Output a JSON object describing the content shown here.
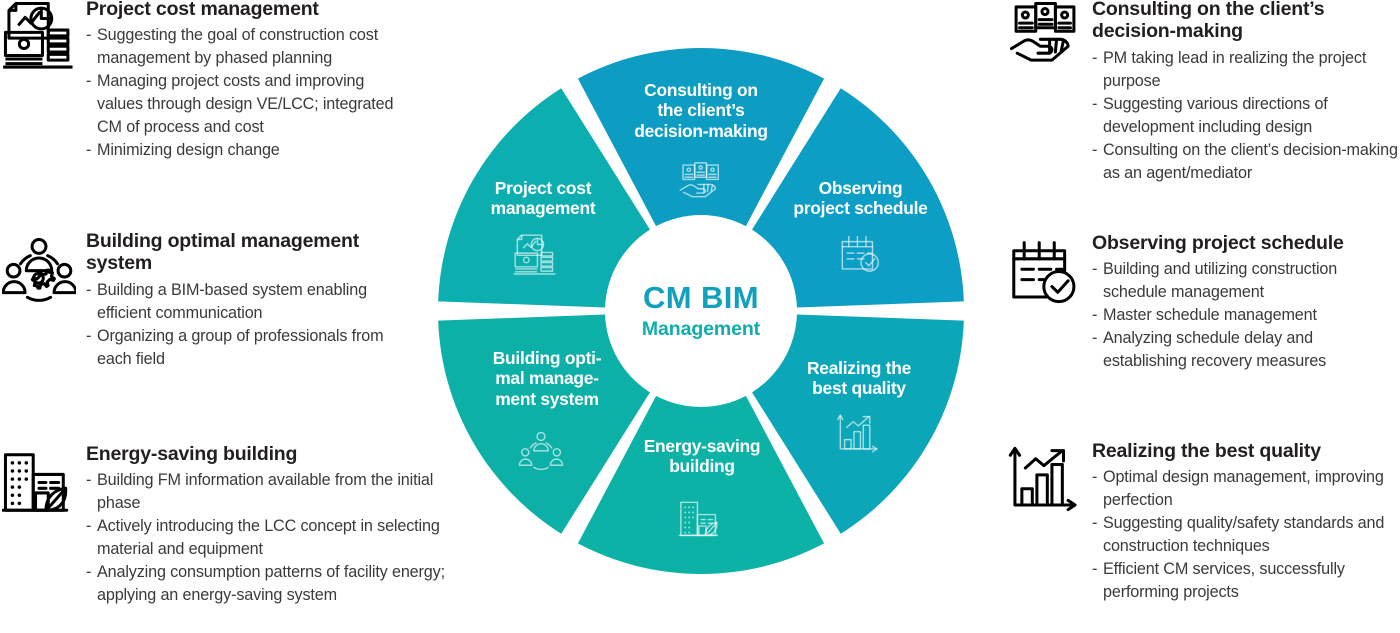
{
  "center": {
    "title": "CM BIM",
    "subtitle": "Management",
    "title_color": "#13A0BC",
    "subtitle_color": "#0FAEAA"
  },
  "colors": {
    "segment_start": "#0C9DC0",
    "segment_end": "#0DB0A5",
    "heading": "#231f20",
    "body": "#3a3a3a",
    "gap": "#ffffff"
  },
  "wheel": {
    "segments": [
      {
        "id": "project-cost-management",
        "label": "Project cost\nmanagement",
        "icon": "money-chart-icon",
        "color": "#0D9DC3"
      },
      {
        "id": "consulting-decision",
        "label": "Consulting on\nthe client’s\ndecision-making",
        "icon": "hand-cards-icon",
        "color": "#0C9EC4"
      },
      {
        "id": "observing-schedule",
        "label": "Observing\nproject schedule",
        "icon": "calendar-check-icon",
        "color": "#0BA7B9"
      },
      {
        "id": "realizing-best-quality",
        "label": "Realizing the\nbest quality",
        "icon": "bar-chart-arrow-icon",
        "color": "#0CB2A6"
      },
      {
        "id": "energy-saving-building",
        "label": "Energy-saving\nbuilding",
        "icon": "building-leaf-icon",
        "color": "#0DB0A7"
      },
      {
        "id": "building-optimal-system",
        "label": "Building opti-\nmal manage-\nment system",
        "icon": "team-gear-icon",
        "color": "#0DAEAF"
      }
    ]
  },
  "blocks": {
    "project_cost": {
      "title": "Project cost management",
      "icon": "money-chart-icon",
      "bullets": [
        "Suggesting the goal of construction cost management by phased planning",
        "Managing project costs and improving values through design VE/LCC; integrated CM of process and cost",
        "Minimizing design change"
      ]
    },
    "building_optimal": {
      "title": "Building optimal management system",
      "icon": "team-gear-icon",
      "bullets": [
        "Building a BIM-based system enabling efficient communication",
        "Organizing a group of professionals from each field"
      ]
    },
    "energy_saving": {
      "title": "Energy-saving building",
      "icon": "building-leaf-icon",
      "bullets": [
        "Building FM information available from the initial phase",
        "Actively introducing the LCC concept in selecting material and equipment",
        "Analyzing consumption patterns of facility energy; applying an energy-saving system"
      ]
    },
    "consulting": {
      "title": "Consulting on the client’s decision-making",
      "icon": "hand-cards-icon",
      "bullets": [
        "PM taking lead in realizing the project purpose",
        "Suggesting various directions of development including design",
        "Consulting on the client’s decision-making as an agent/mediator"
      ]
    },
    "observing_schedule": {
      "title": "Observing project schedule",
      "icon": "calendar-check-icon",
      "bullets": [
        "Building and utilizing construction schedule management",
        "Master schedule management",
        "Analyzing schedule delay and establishing recovery measures"
      ]
    },
    "realizing_quality": {
      "title": "Realizing the best quality",
      "icon": "bar-chart-arrow-icon",
      "bullets": [
        "Optimal design management, improving perfection",
        "Suggesting quality/safety standards and construction techniques",
        "Efficient CM services, successfully performing projects"
      ]
    }
  }
}
